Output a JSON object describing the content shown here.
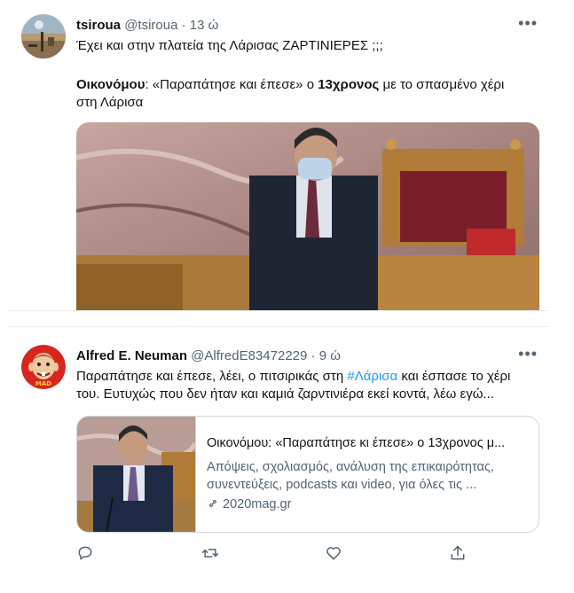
{
  "tweets": [
    {
      "author_name": "tsiroua",
      "handle": "@tsiroua",
      "time": "13 ώ",
      "text_line1": "Έχει και στην πλατεία της Λάρισας ΖΑΡΤΙΝΙΕΡΕΣ ;;;",
      "quote_bold1": "Οικονόμου",
      "quote_text1": ": «Παραπάτησε και έπεσε» ο ",
      "quote_bold2": "13χρονος",
      "quote_text2": " με το σπασμένο χέρι",
      "quote_line2": "στη Λάρισα",
      "more_icon": "more-icon"
    },
    {
      "author_name": "Alfred E. Neuman",
      "handle": "@AlfredE83472229",
      "time": "9 ώ",
      "text_a": "Παραπάτησε και έπεσε, λέει, ο πιτσιρικάς στη ",
      "hashtag": "#Λάρισα",
      "text_b": " και έσπασε το χέρι",
      "text_line2": "του. Ευτυχώς που δεν ήταν και καμιά ζαρντινιέρα εκεί κοντά, λέω εγώ...",
      "card": {
        "title": "Οικονόμου: «Παραπάτησε κι έπεσε» ο 13χρονος μ...",
        "desc_line1": "Απόψεις, σχολιασμός, ανάλυση της επικαιρότητας,",
        "desc_line2": "συνεντεύξεις, podcasts και video, για όλες τις ...",
        "domain": "2020mag.gr"
      },
      "avatar_text": "MAD"
    }
  ],
  "accent": "#1d9bf0",
  "icons": [
    "reply-icon",
    "retweet-icon",
    "like-icon",
    "share-icon",
    "link-icon"
  ]
}
